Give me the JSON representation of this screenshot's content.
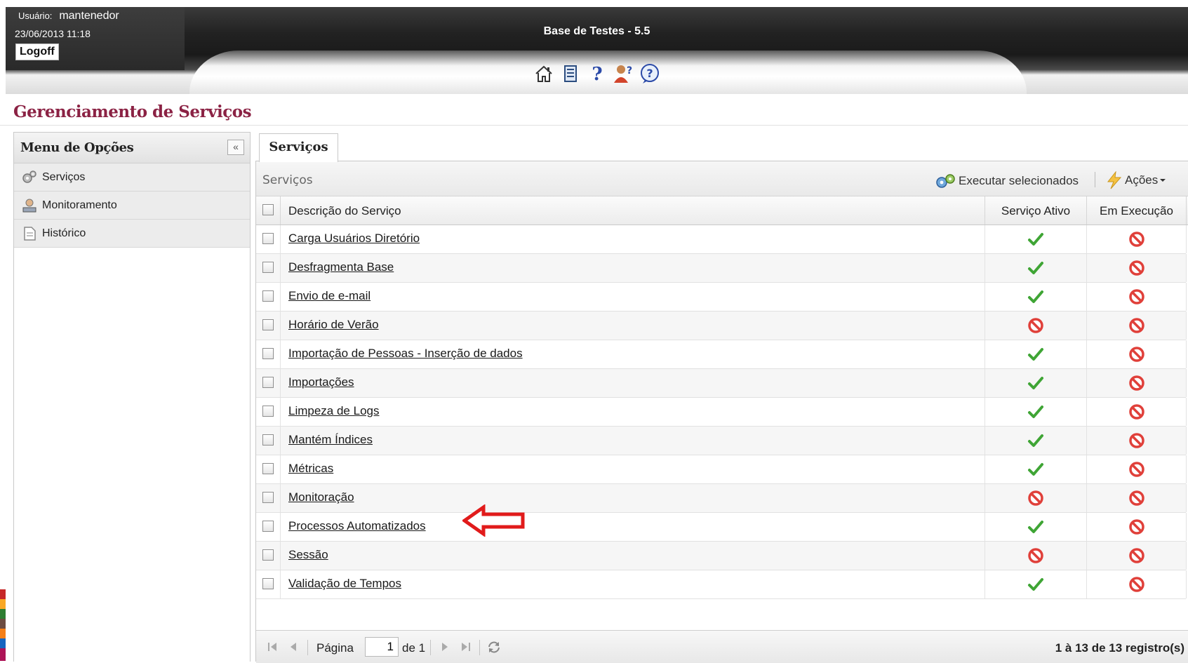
{
  "header": {
    "user_label": "Usuário:",
    "user_name": "mantenedor",
    "datetime": "23/06/2013 11:18",
    "logoff_label": "Logoff",
    "app_title": "Base de Testes - 5.5",
    "icons": [
      "home-icon",
      "notebook-icon",
      "help-question-icon",
      "user-help-icon",
      "help-circle-icon"
    ]
  },
  "page_title": "Gerenciamento de Serviços",
  "left_menu": {
    "title": "Menu de Opções",
    "collapse_symbol": "«",
    "items": [
      {
        "label": "Serviços",
        "icon": "gears-icon"
      },
      {
        "label": "Monitoramento",
        "icon": "monitor-user-icon"
      },
      {
        "label": "Histórico",
        "icon": "document-icon"
      }
    ]
  },
  "tab": {
    "label": "Serviços"
  },
  "grid": {
    "caption": "Serviços",
    "toolbar": {
      "execute_label": "Executar selecionados",
      "actions_label": "Ações"
    },
    "columns": [
      "Descrição do Serviço",
      "Serviço Ativo",
      "Em Execução"
    ],
    "rows": [
      {
        "desc": "Carga Usuários Diretório",
        "ativo": true,
        "exec": false
      },
      {
        "desc": "Desfragmenta Base",
        "ativo": true,
        "exec": false
      },
      {
        "desc": "Envio de e-mail",
        "ativo": true,
        "exec": false
      },
      {
        "desc": "Horário de Verão",
        "ativo": false,
        "exec": false
      },
      {
        "desc": "Importação de Pessoas - Inserção de dados",
        "ativo": true,
        "exec": false
      },
      {
        "desc": "Importações",
        "ativo": true,
        "exec": false
      },
      {
        "desc": "Limpeza de Logs",
        "ativo": true,
        "exec": false
      },
      {
        "desc": "Mantém Índices",
        "ativo": true,
        "exec": false
      },
      {
        "desc": "Métricas",
        "ativo": true,
        "exec": false
      },
      {
        "desc": "Monitoração",
        "ativo": false,
        "exec": false
      },
      {
        "desc": "Processos Automatizados",
        "ativo": true,
        "exec": false
      },
      {
        "desc": "Sessão",
        "ativo": false,
        "exec": false
      },
      {
        "desc": "Validação de Tempos",
        "ativo": true,
        "exec": false
      }
    ],
    "pager": {
      "page_label": "Página",
      "page_value": "1",
      "of_label": "de 1",
      "info": "1 à 13 de 13 registro(s)"
    }
  },
  "colors": {
    "title": "#8b2244",
    "check_green": "#3fa535",
    "block_red": "#e0403a",
    "annotation_arrow": "#e11b1b"
  }
}
